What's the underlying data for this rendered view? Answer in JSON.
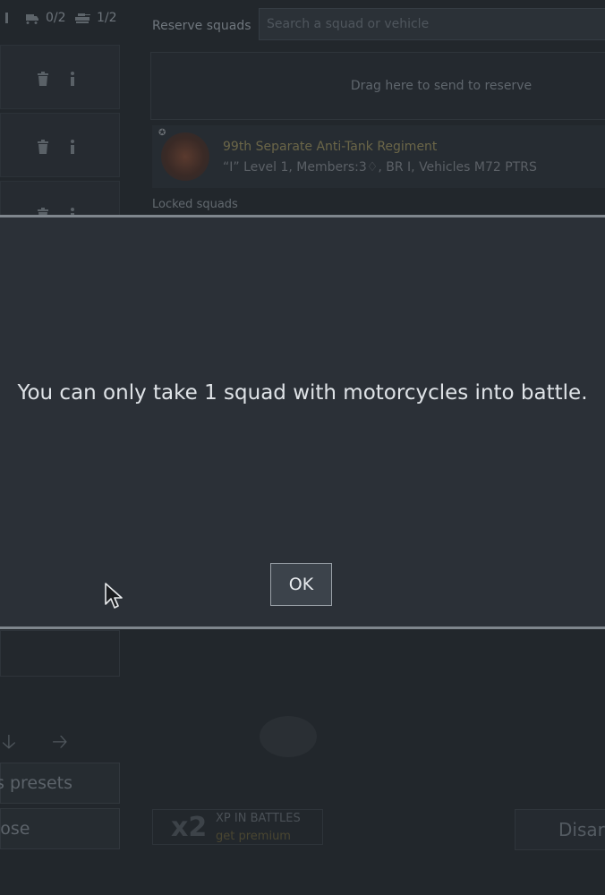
{
  "topbar": {
    "stat_a": "0/2",
    "stat_b": "1/2",
    "reserve_label": "Reserve squads",
    "search_placeholder": "Search a squad or vehicle"
  },
  "reserve": {
    "drop_hint": "Drag here to send to reserve",
    "squad": {
      "name": "99th Separate Anti-Tank Regiment",
      "meta": "“I” Level 1, Members:3♢,  BR I,  Vehicles M72 PTRS"
    },
    "locked_label": "Locked squads"
  },
  "lower": {
    "presets_label": "s presets",
    "close_label": "lose",
    "promo_multiplier": "x2",
    "promo_title": "XP IN BATTLES",
    "promo_link": "get premium",
    "disarm_label": "Disar"
  },
  "dialog": {
    "message": "You can only take 1 squad with motorcycles into battle.",
    "ok_label": "OK"
  },
  "icons": {
    "slot_actions": [
      "trash-icon",
      "info-icon"
    ],
    "arrows": [
      "arrow-down-icon",
      "arrow-right-icon"
    ]
  },
  "colors": {
    "dialog_border": "#7f868d",
    "dialog_bg": "#2b3037",
    "premium_gold": "#4a4631"
  }
}
